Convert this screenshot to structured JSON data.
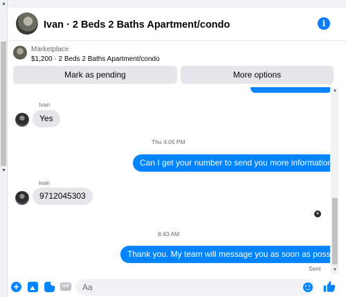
{
  "header": {
    "title": "Ivan · 2 Beds 2 Baths Apartment/condo",
    "avatar_icon": "contact-avatar",
    "info_icon_glyph": "i"
  },
  "listing": {
    "source": "Marketplace",
    "detail": "$1,200 · 2 Beds 2 Baths Apartment/condo"
  },
  "actions": {
    "mark_pending": "Mark as pending",
    "more_options": "More options"
  },
  "messages": {
    "msg1": {
      "sender": "Ivan",
      "text": "Yes"
    },
    "time1": "Thu 4:05 PM",
    "msg2": {
      "text": "Can I get your number to send you more information?"
    },
    "msg3": {
      "sender": "Ivan",
      "text": "9712045303"
    },
    "time2": "8:43 AM",
    "msg4": {
      "text": "Thank you. My team will message you as soon as possible."
    },
    "status": "Sent"
  },
  "composer": {
    "placeholder": "Aa",
    "plus_glyph": "+",
    "gif_label": "GIF"
  },
  "scroll": {
    "up_glyph": "▲",
    "down_glyph": "▼"
  },
  "colors": {
    "accent": "#0084ff",
    "incoming_bubble": "#e4e6eb",
    "secondary_text": "#65676b"
  }
}
